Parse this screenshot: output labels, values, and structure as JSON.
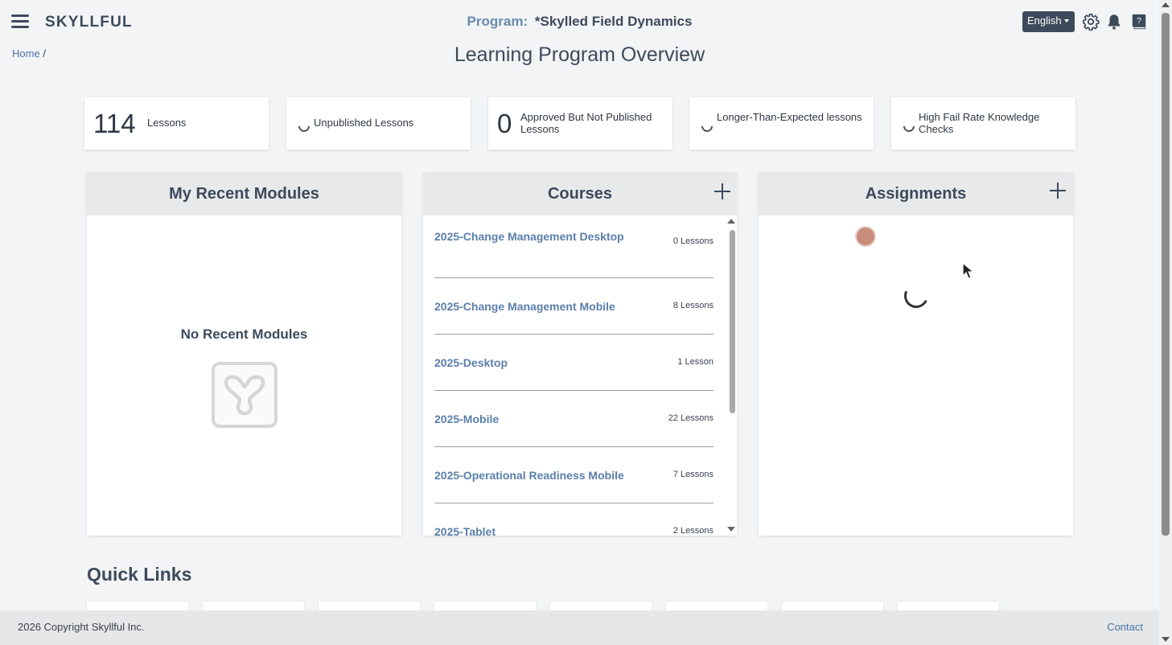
{
  "app": {
    "logo": "SKYLLFUL"
  },
  "header": {
    "program_label": "Program:",
    "program_name": "*Skylled Field Dynamics",
    "language": "English"
  },
  "breadcrumb": {
    "home": "Home",
    "separator": "/"
  },
  "page_title": "Learning Program Overview",
  "stats": [
    {
      "value": "114",
      "label": "Lessons",
      "loading": false
    },
    {
      "value": "",
      "label": "Unpublished Lessons",
      "loading": true
    },
    {
      "value": "0",
      "label": "Approved But Not Published Lessons",
      "loading": false
    },
    {
      "value": "",
      "label": "Longer-Than-Expected lessons",
      "loading": true
    },
    {
      "value": "",
      "label": "High Fail Rate Knowledge Checks",
      "loading": true
    }
  ],
  "recent_modules": {
    "title": "My Recent Modules",
    "empty_text": "No Recent Modules"
  },
  "courses": {
    "title": "Courses",
    "items": [
      {
        "name": "2025-Change Management Desktop",
        "count": "0 Lessons"
      },
      {
        "name": "2025-Change Management Mobile",
        "count": "8 Lessons"
      },
      {
        "name": "2025-Desktop",
        "count": "1 Lesson"
      },
      {
        "name": "2025-Mobile",
        "count": "22 Lessons"
      },
      {
        "name": "2025-Operational Readiness Mobile",
        "count": "7 Lessons"
      },
      {
        "name": "2025-Tablet",
        "count": "2 Lessons"
      }
    ]
  },
  "assignments": {
    "title": "Assignments"
  },
  "quick_links": {
    "title": "Quick Links"
  },
  "footer": {
    "copyright": "2026 Copyright Skyllful Inc.",
    "contact": "Contact"
  },
  "colors": {
    "nav_dark": "#3d4a5c",
    "link": "#5a7fab",
    "panel_header": "#e8e9ea",
    "avatar": "#c98c7a"
  }
}
